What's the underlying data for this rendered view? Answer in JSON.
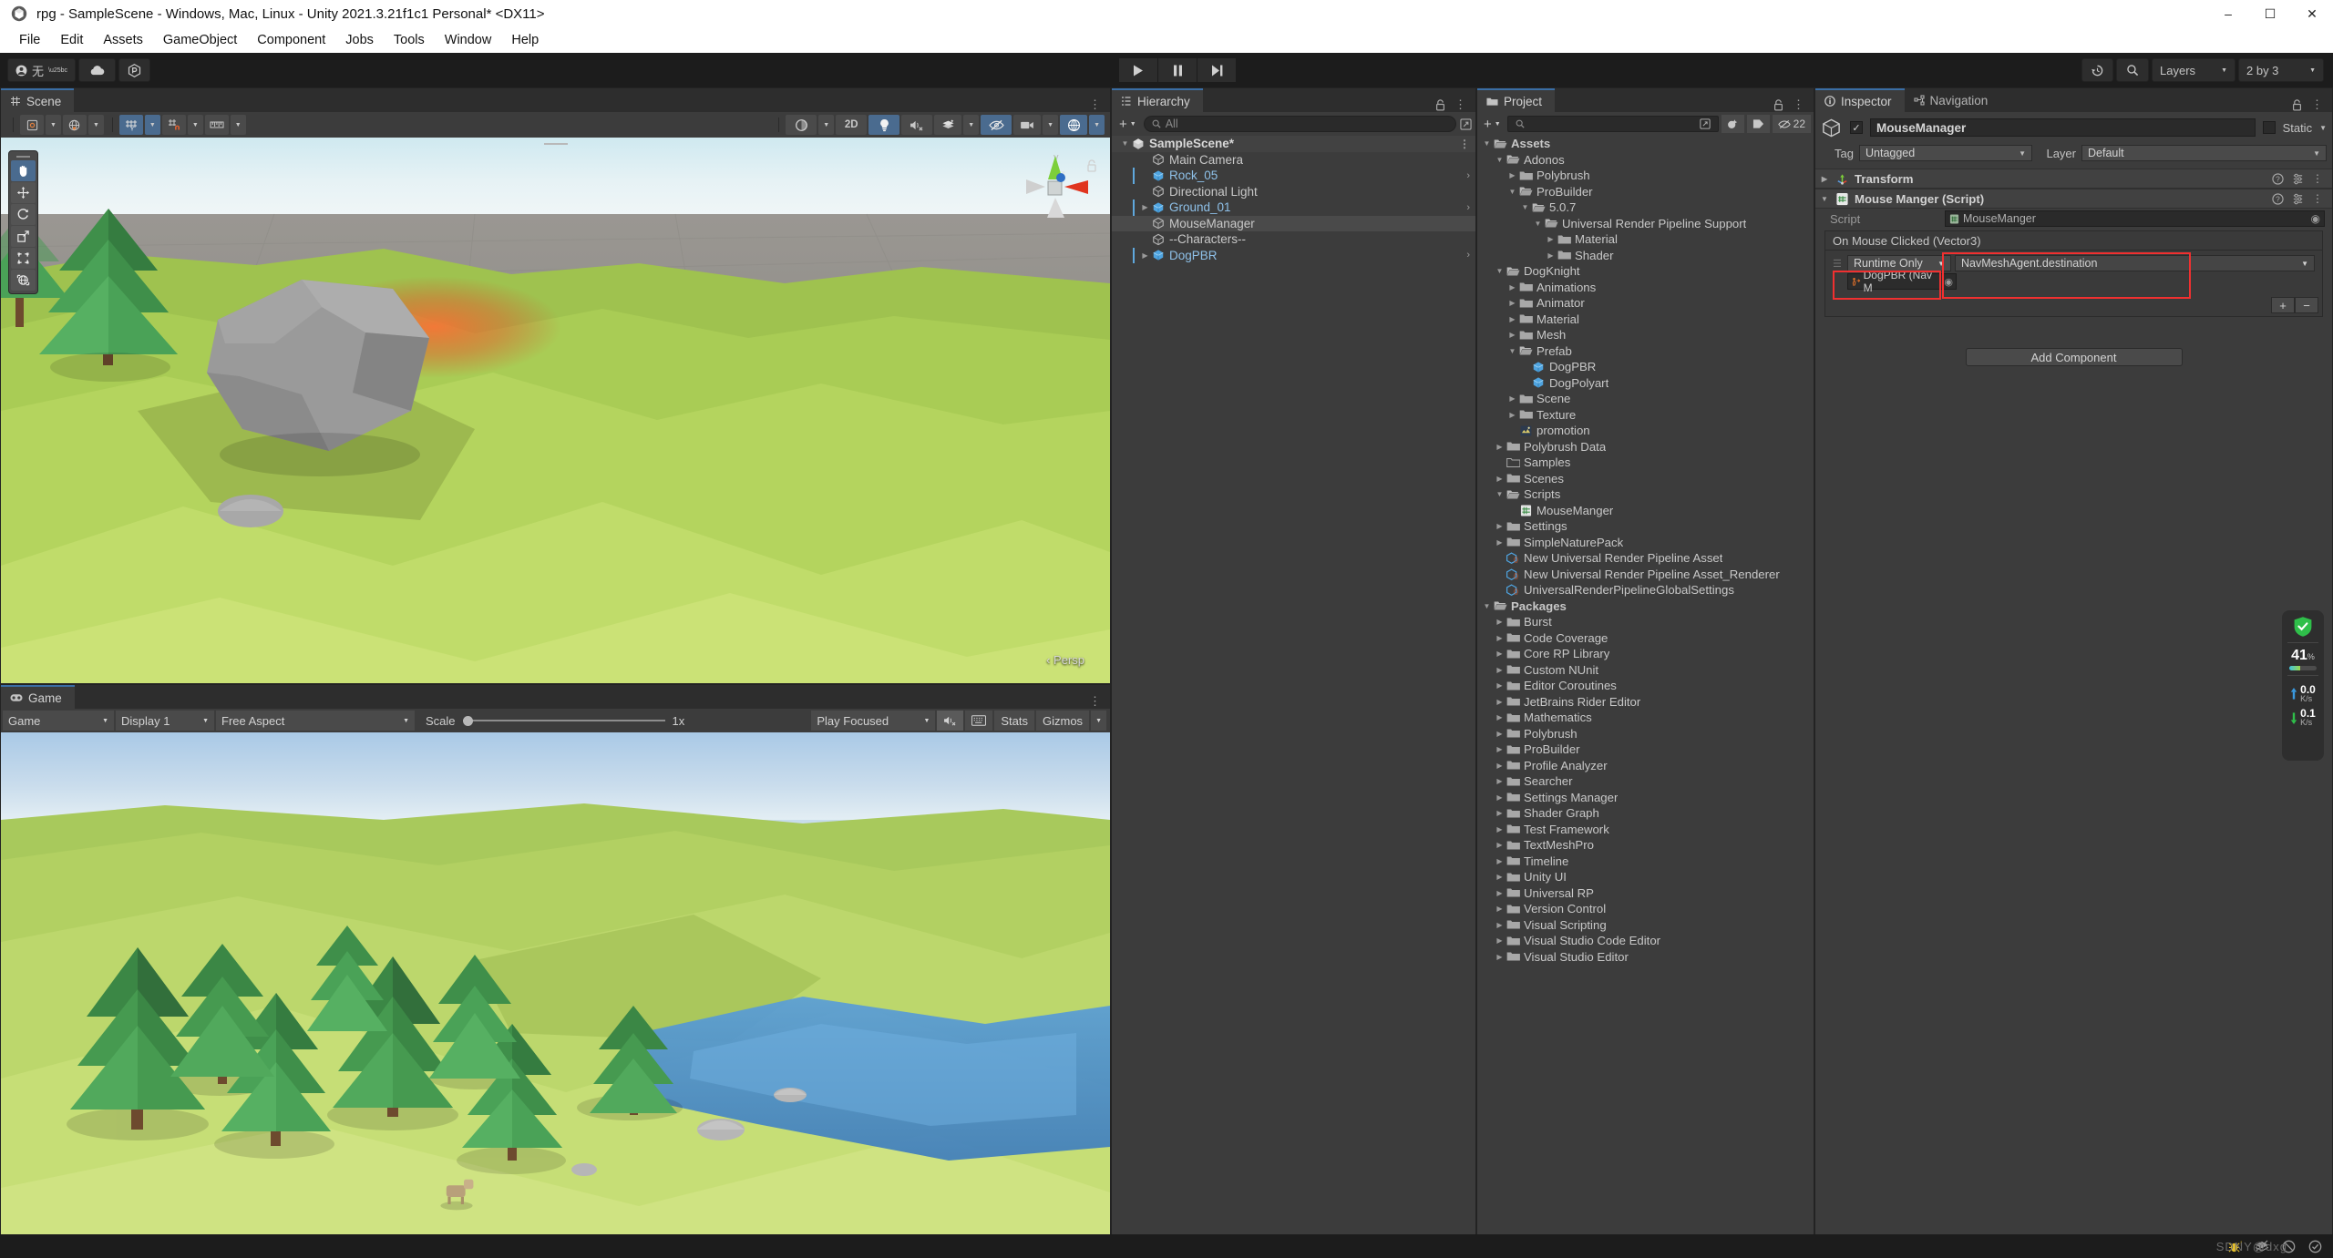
{
  "window": {
    "title": "rpg - SampleScene - Windows, Mac, Linux - Unity 2021.3.21f1c1 Personal* <DX11>",
    "minimize": "–",
    "maximize": "☐",
    "close": "✕"
  },
  "menubar": {
    "items": [
      "File",
      "Edit",
      "Assets",
      "GameObject",
      "Component",
      "Jobs",
      "Tools",
      "Window",
      "Help"
    ]
  },
  "toolbar": {
    "account_label": "无",
    "layers_label": "Layers",
    "layout_label": "2 by 3",
    "play": "▶",
    "pause": "‖",
    "step": "▶|"
  },
  "scene": {
    "tab_label": "Scene",
    "tools": [
      "hand-tool",
      "move-tool",
      "rotate-tool",
      "scale-tool",
      "rect-tool",
      "transform-tool"
    ],
    "toolbar_right": {
      "twod": "2D",
      "shading": "Shaded"
    },
    "persp_label": "‹ Persp",
    "gizmo_axes": {
      "x": "x",
      "y": "y",
      "z": "z"
    }
  },
  "game": {
    "tab_label": "Game",
    "target": "Game",
    "display": "Display 1",
    "aspect": "Free Aspect",
    "scale_label": "Scale",
    "scale_value": "1x",
    "play_mode": "Play Focused",
    "stats": "Stats",
    "gizmos": "Gizmos"
  },
  "hierarchy": {
    "tab_label": "Hierarchy",
    "search_placeholder": "All",
    "items": [
      {
        "label": "SampleScene*",
        "depth": 0,
        "icon": "unity-scene-icon",
        "expanded": true,
        "root": true,
        "prefab": false,
        "selected": false,
        "chevron": false,
        "bar": false,
        "dots": true
      },
      {
        "label": "Main Camera",
        "depth": 2,
        "icon": "gameobject-icon",
        "expanded": null,
        "root": false,
        "prefab": false,
        "selected": false,
        "chevron": false,
        "bar": false,
        "dots": false
      },
      {
        "label": "Rock_05",
        "depth": 2,
        "icon": "prefab-icon",
        "expanded": null,
        "root": false,
        "prefab": true,
        "selected": false,
        "chevron": true,
        "bar": true,
        "dots": false
      },
      {
        "label": "Directional Light",
        "depth": 2,
        "icon": "gameobject-icon",
        "expanded": null,
        "root": false,
        "prefab": false,
        "selected": false,
        "chevron": false,
        "bar": false,
        "dots": false
      },
      {
        "label": "Ground_01",
        "depth": 2,
        "icon": "prefab-icon",
        "expanded": false,
        "root": false,
        "prefab": true,
        "selected": false,
        "chevron": true,
        "bar": true,
        "dots": false
      },
      {
        "label": "MouseManager",
        "depth": 2,
        "icon": "gameobject-icon",
        "expanded": null,
        "root": false,
        "prefab": false,
        "selected": true,
        "chevron": false,
        "bar": false,
        "dots": false
      },
      {
        "label": "--Characters--",
        "depth": 2,
        "icon": "gameobject-icon",
        "expanded": null,
        "root": false,
        "prefab": false,
        "selected": false,
        "chevron": false,
        "bar": false,
        "dots": false
      },
      {
        "label": "DogPBR",
        "depth": 2,
        "icon": "prefab-icon",
        "expanded": false,
        "root": false,
        "prefab": true,
        "selected": false,
        "chevron": true,
        "bar": true,
        "dots": false
      }
    ]
  },
  "project": {
    "tab_label": "Project",
    "search_placeholder": "",
    "hidden_count": "22",
    "items": [
      {
        "label": "Assets",
        "depth": 0,
        "icon": "folder-open-icon",
        "expanded": true,
        "bold": true
      },
      {
        "label": "Adonos",
        "depth": 1,
        "icon": "folder-open-icon",
        "expanded": true,
        "bold": false
      },
      {
        "label": "Polybrush",
        "depth": 2,
        "icon": "folder-icon",
        "expanded": false,
        "bold": false
      },
      {
        "label": "ProBuilder",
        "depth": 2,
        "icon": "folder-open-icon",
        "expanded": true,
        "bold": false
      },
      {
        "label": "5.0.7",
        "depth": 3,
        "icon": "folder-open-icon",
        "expanded": true,
        "bold": false
      },
      {
        "label": "Universal Render Pipeline Support",
        "depth": 4,
        "icon": "folder-open-icon",
        "expanded": true,
        "bold": false
      },
      {
        "label": "Material",
        "depth": 5,
        "icon": "folder-icon",
        "expanded": false,
        "bold": false
      },
      {
        "label": "Shader",
        "depth": 5,
        "icon": "folder-icon",
        "expanded": false,
        "bold": false
      },
      {
        "label": "DogKnight",
        "depth": 1,
        "icon": "folder-open-icon",
        "expanded": true,
        "bold": false
      },
      {
        "label": "Animations",
        "depth": 2,
        "icon": "folder-icon",
        "expanded": false,
        "bold": false
      },
      {
        "label": "Animator",
        "depth": 2,
        "icon": "folder-icon",
        "expanded": false,
        "bold": false
      },
      {
        "label": "Material",
        "depth": 2,
        "icon": "folder-icon",
        "expanded": false,
        "bold": false
      },
      {
        "label": "Mesh",
        "depth": 2,
        "icon": "folder-icon",
        "expanded": false,
        "bold": false
      },
      {
        "label": "Prefab",
        "depth": 2,
        "icon": "folder-open-icon",
        "expanded": true,
        "bold": false
      },
      {
        "label": "DogPBR",
        "depth": 3,
        "icon": "prefab-icon",
        "expanded": null,
        "bold": false
      },
      {
        "label": "DogPolyart",
        "depth": 3,
        "icon": "prefab-icon",
        "expanded": null,
        "bold": false
      },
      {
        "label": "Scene",
        "depth": 2,
        "icon": "folder-icon",
        "expanded": false,
        "bold": false
      },
      {
        "label": "Texture",
        "depth": 2,
        "icon": "folder-icon",
        "expanded": false,
        "bold": false
      },
      {
        "label": "promotion",
        "depth": 2,
        "icon": "texture-icon",
        "expanded": null,
        "bold": false
      },
      {
        "label": "Polybrush Data",
        "depth": 1,
        "icon": "folder-icon",
        "expanded": false,
        "bold": false
      },
      {
        "label": "Samples",
        "depth": 1,
        "icon": "folder-empty-icon",
        "expanded": null,
        "bold": false
      },
      {
        "label": "Scenes",
        "depth": 1,
        "icon": "folder-icon",
        "expanded": false,
        "bold": false
      },
      {
        "label": "Scripts",
        "depth": 1,
        "icon": "folder-open-icon",
        "expanded": true,
        "bold": false
      },
      {
        "label": "MouseManger",
        "depth": 2,
        "icon": "csharp-script-icon",
        "expanded": null,
        "bold": false
      },
      {
        "label": "Settings",
        "depth": 1,
        "icon": "folder-icon",
        "expanded": false,
        "bold": false
      },
      {
        "label": "SimpleNaturePack",
        "depth": 1,
        "icon": "folder-icon",
        "expanded": false,
        "bold": false
      },
      {
        "label": "New Universal Render Pipeline Asset",
        "depth": 1,
        "icon": "scriptable-object-icon",
        "expanded": null,
        "bold": false
      },
      {
        "label": "New Universal Render Pipeline Asset_Renderer",
        "depth": 1,
        "icon": "scriptable-object-icon",
        "expanded": null,
        "bold": false
      },
      {
        "label": "UniversalRenderPipelineGlobalSettings",
        "depth": 1,
        "icon": "scriptable-object-icon",
        "expanded": null,
        "bold": false
      },
      {
        "label": "Packages",
        "depth": 0,
        "icon": "folder-open-icon",
        "expanded": true,
        "bold": true
      },
      {
        "label": "Burst",
        "depth": 1,
        "icon": "folder-icon",
        "expanded": false,
        "bold": false
      },
      {
        "label": "Code Coverage",
        "depth": 1,
        "icon": "folder-icon",
        "expanded": false,
        "bold": false
      },
      {
        "label": "Core RP Library",
        "depth": 1,
        "icon": "folder-icon",
        "expanded": false,
        "bold": false
      },
      {
        "label": "Custom NUnit",
        "depth": 1,
        "icon": "folder-icon",
        "expanded": false,
        "bold": false
      },
      {
        "label": "Editor Coroutines",
        "depth": 1,
        "icon": "folder-icon",
        "expanded": false,
        "bold": false
      },
      {
        "label": "JetBrains Rider Editor",
        "depth": 1,
        "icon": "folder-icon",
        "expanded": false,
        "bold": false
      },
      {
        "label": "Mathematics",
        "depth": 1,
        "icon": "folder-icon",
        "expanded": false,
        "bold": false
      },
      {
        "label": "Polybrush",
        "depth": 1,
        "icon": "folder-icon",
        "expanded": false,
        "bold": false
      },
      {
        "label": "ProBuilder",
        "depth": 1,
        "icon": "folder-icon",
        "expanded": false,
        "bold": false
      },
      {
        "label": "Profile Analyzer",
        "depth": 1,
        "icon": "folder-icon",
        "expanded": false,
        "bold": false
      },
      {
        "label": "Searcher",
        "depth": 1,
        "icon": "folder-icon",
        "expanded": false,
        "bold": false
      },
      {
        "label": "Settings Manager",
        "depth": 1,
        "icon": "folder-icon",
        "expanded": false,
        "bold": false
      },
      {
        "label": "Shader Graph",
        "depth": 1,
        "icon": "folder-icon",
        "expanded": false,
        "bold": false
      },
      {
        "label": "Test Framework",
        "depth": 1,
        "icon": "folder-icon",
        "expanded": false,
        "bold": false
      },
      {
        "label": "TextMeshPro",
        "depth": 1,
        "icon": "folder-icon",
        "expanded": false,
        "bold": false
      },
      {
        "label": "Timeline",
        "depth": 1,
        "icon": "folder-icon",
        "expanded": false,
        "bold": false
      },
      {
        "label": "Unity UI",
        "depth": 1,
        "icon": "folder-icon",
        "expanded": false,
        "bold": false
      },
      {
        "label": "Universal RP",
        "depth": 1,
        "icon": "folder-icon",
        "expanded": false,
        "bold": false
      },
      {
        "label": "Version Control",
        "depth": 1,
        "icon": "folder-icon",
        "expanded": false,
        "bold": false
      },
      {
        "label": "Visual Scripting",
        "depth": 1,
        "icon": "folder-icon",
        "expanded": false,
        "bold": false
      },
      {
        "label": "Visual Studio Code Editor",
        "depth": 1,
        "icon": "folder-icon",
        "expanded": false,
        "bold": false
      },
      {
        "label": "Visual Studio Editor",
        "depth": 1,
        "icon": "folder-icon",
        "expanded": false,
        "bold": false
      }
    ]
  },
  "inspector": {
    "tab_label": "Inspector",
    "nav_tab_label": "Navigation",
    "object_name": "MouseManager",
    "static_label": "Static",
    "tag_label": "Tag",
    "tag_value": "Untagged",
    "layer_label": "Layer",
    "layer_value": "Default",
    "transform_label": "Transform",
    "script_comp_label": "Mouse Manger (Script)",
    "script_field_label": "Script",
    "script_field_value": "MouseManger",
    "event_title": "On Mouse Clicked (Vector3)",
    "event_mode": "Runtime Only",
    "event_function": "NavMeshAgent.destination",
    "event_object": "DogPBR (Nav M",
    "add_button": "+",
    "remove_button": "−",
    "add_component_label": "Add Component",
    "highlight_color": "#f03030"
  },
  "netwidget": {
    "percent": "41",
    "percent_unit": "%",
    "upload_value": "0.0",
    "upload_unit": "K/s",
    "download_value": "0.1",
    "download_unit": "K/s"
  },
  "statusbar": {
    "watermark": "SDNY@dxg"
  }
}
